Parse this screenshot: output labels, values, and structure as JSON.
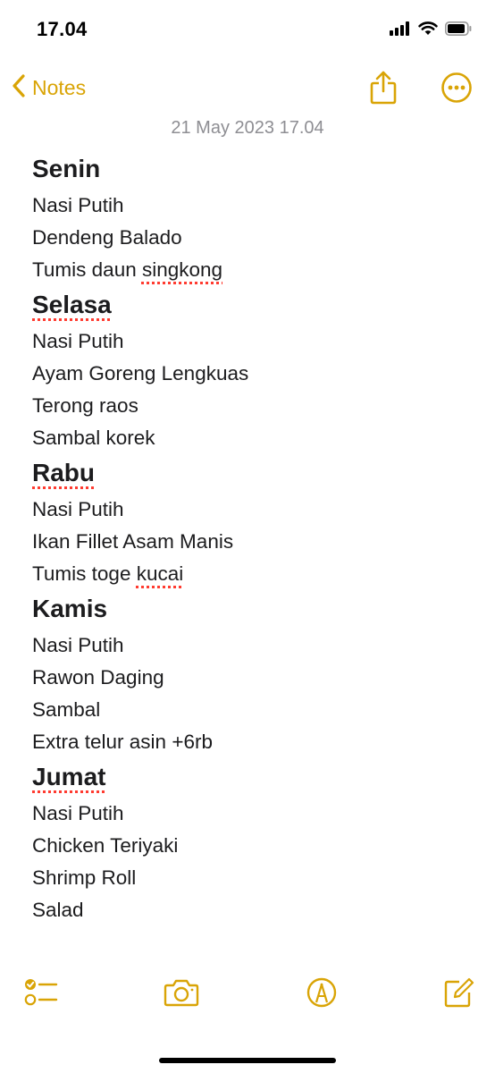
{
  "status_bar": {
    "time": "17.04",
    "icons": [
      "cellular-signal-icon",
      "wifi-icon",
      "battery-icon"
    ]
  },
  "nav": {
    "back_label": "Notes",
    "back_icon": "chevron-left-icon",
    "share_icon": "share-icon",
    "more_icon": "ellipsis-circle-icon"
  },
  "note": {
    "date": "21 May 2023 17.04",
    "days": [
      {
        "name": "Senin",
        "items": [
          "Nasi Putih",
          "Dendeng Balado",
          "Tumis daun singkong"
        ]
      },
      {
        "name": "Selasa",
        "items": [
          "Nasi Putih",
          "Ayam Goreng Lengkuas",
          "Terong raos",
          "Sambal korek"
        ]
      },
      {
        "name": "Rabu",
        "items": [
          "Nasi Putih",
          "Ikan Fillet Asam Manis",
          "Tumis toge kucai"
        ]
      },
      {
        "name": "Kamis",
        "items": [
          "Nasi Putih",
          "Rawon Daging",
          "Sambal",
          "Extra telur asin +6rb"
        ]
      },
      {
        "name": "Jumat",
        "items": [
          "Nasi Putih",
          "Chicken Teriyaki",
          "Shrimp Roll",
          "Salad"
        ]
      }
    ]
  },
  "toolbar": {
    "icons": [
      "checklist-icon",
      "camera-icon",
      "markup-pen-icon",
      "compose-icon"
    ]
  },
  "colors": {
    "accent": "#d9a406",
    "text": "#1c1c1e",
    "muted": "#8e8e93",
    "spellcheck": "#ff3b30"
  }
}
